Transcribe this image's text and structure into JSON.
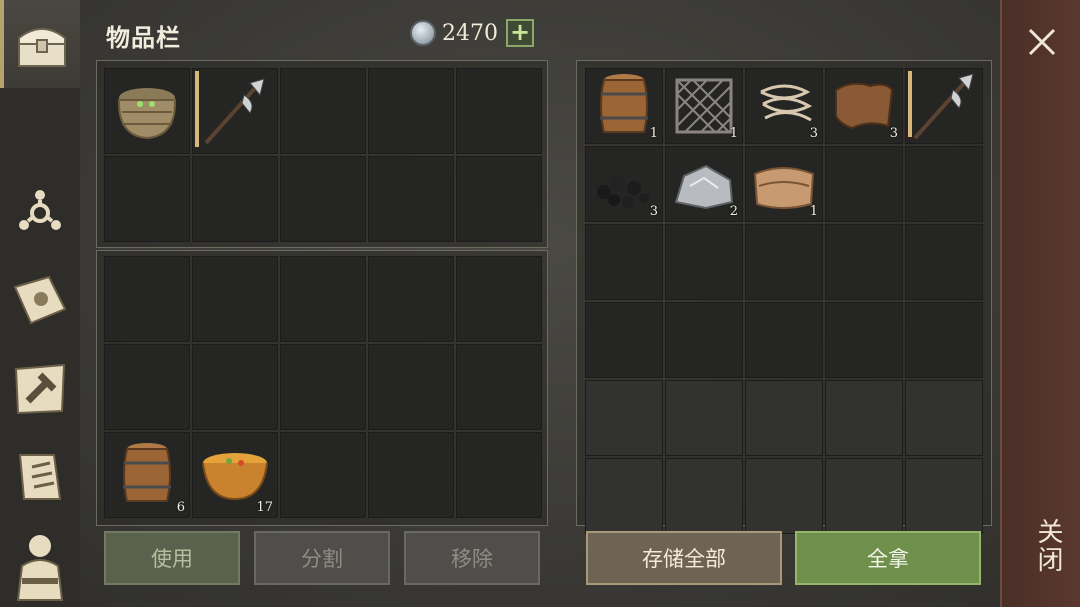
{
  "header": {
    "title": "物品栏",
    "coins": "2470"
  },
  "sidebar": {
    "tabs": [
      "chest-icon",
      "radiation-icon",
      "journal-icon",
      "craft-icon",
      "quest-scroll-icon",
      "character-icon"
    ]
  },
  "left_inventory": {
    "top": [
      {
        "icon": "wicker-basket-icon"
      },
      {
        "icon": "halberd-icon",
        "durability": true
      },
      {},
      {},
      {},
      {},
      {},
      {},
      {},
      {}
    ],
    "bottom": [
      {},
      {},
      {},
      {},
      {},
      {},
      {},
      {},
      {},
      {},
      {
        "icon": "wooden-barrel-icon",
        "qty": "6"
      },
      {
        "icon": "soup-bowl-icon",
        "qty": "17"
      },
      {},
      {},
      {}
    ]
  },
  "right_storage": {
    "slots": [
      {
        "icon": "wooden-barrel-icon",
        "qty": "1"
      },
      {
        "icon": "iron-grate-icon",
        "qty": "1"
      },
      {
        "icon": "rope-icon",
        "qty": "3"
      },
      {
        "icon": "leather-icon",
        "qty": "3"
      },
      {
        "icon": "halberd-icon",
        "durability": true
      },
      {
        "icon": "coal-icon",
        "qty": "3"
      },
      {
        "icon": "iron-ore-icon",
        "qty": "2"
      },
      {
        "icon": "cloth-icon",
        "qty": "1"
      },
      {},
      {},
      {},
      {},
      {},
      {},
      {},
      {},
      {},
      {},
      {},
      {},
      {},
      {},
      {},
      {},
      {},
      {},
      {},
      {},
      {},
      {}
    ]
  },
  "buttons": {
    "use": "使用",
    "split": "分割",
    "remove": "移除",
    "store_all": "存储全部",
    "take_all": "全拿"
  },
  "close": {
    "label": "关闭"
  }
}
